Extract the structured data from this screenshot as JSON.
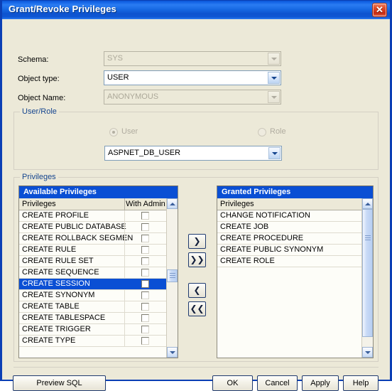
{
  "window": {
    "title": "Grant/Revoke Privileges",
    "close_icon": "close-icon",
    "close_glyph": "✕"
  },
  "form": {
    "schema": {
      "label": "Schema:",
      "value": "SYS",
      "disabled": true
    },
    "object_type": {
      "label": "Object type:",
      "value": "USER",
      "disabled": false
    },
    "object_name": {
      "label": "Object Name:",
      "value": "ANONYMOUS",
      "disabled": true
    }
  },
  "user_role": {
    "group_title": "User/Role",
    "radio_user": {
      "label": "User",
      "checked": true,
      "disabled": true
    },
    "radio_role": {
      "label": "Role",
      "checked": false,
      "disabled": true
    },
    "selection": {
      "value": "ASPNET_DB_USER",
      "disabled": false
    }
  },
  "privileges": {
    "group_title": "Privileges",
    "available": {
      "header": "Available Privileges",
      "columns": [
        "Privileges",
        "With Admin"
      ],
      "rows": [
        {
          "name": "CREATE PROFILE",
          "with_admin": false,
          "selected": false
        },
        {
          "name": "CREATE PUBLIC DATABASE",
          "with_admin": false,
          "selected": false
        },
        {
          "name": "CREATE ROLLBACK SEGMEN",
          "with_admin": false,
          "selected": false
        },
        {
          "name": "CREATE RULE",
          "with_admin": false,
          "selected": false
        },
        {
          "name": "CREATE RULE SET",
          "with_admin": false,
          "selected": false
        },
        {
          "name": "CREATE SEQUENCE",
          "with_admin": false,
          "selected": false
        },
        {
          "name": "CREATE SESSION",
          "with_admin": false,
          "selected": true
        },
        {
          "name": "CREATE SYNONYM",
          "with_admin": false,
          "selected": false
        },
        {
          "name": "CREATE TABLE",
          "with_admin": false,
          "selected": false
        },
        {
          "name": "CREATE TABLESPACE",
          "with_admin": false,
          "selected": false
        },
        {
          "name": "CREATE TRIGGER",
          "with_admin": false,
          "selected": false
        },
        {
          "name": "CREATE TYPE",
          "with_admin": false,
          "selected": false
        }
      ]
    },
    "granted": {
      "header": "Granted Privileges",
      "columns": [
        "Privileges"
      ],
      "rows": [
        {
          "name": "CHANGE NOTIFICATION"
        },
        {
          "name": "CREATE JOB"
        },
        {
          "name": "CREATE PROCEDURE"
        },
        {
          "name": "CREATE PUBLIC SYNONYM"
        },
        {
          "name": "CREATE ROLE"
        }
      ]
    },
    "transfer": {
      "grant_one": "❯",
      "grant_all": "❯❯",
      "revoke_one": "❮",
      "revoke_all": "❮❮"
    }
  },
  "footer": {
    "preview_sql": "Preview SQL",
    "ok": "OK",
    "cancel": "Cancel",
    "apply": "Apply",
    "help": "Help"
  },
  "colors": {
    "title_blue": "#0a57d8",
    "selection_blue": "#0a4fd4",
    "dialog_bg": "#ece9d8",
    "group_label": "#15458f"
  }
}
